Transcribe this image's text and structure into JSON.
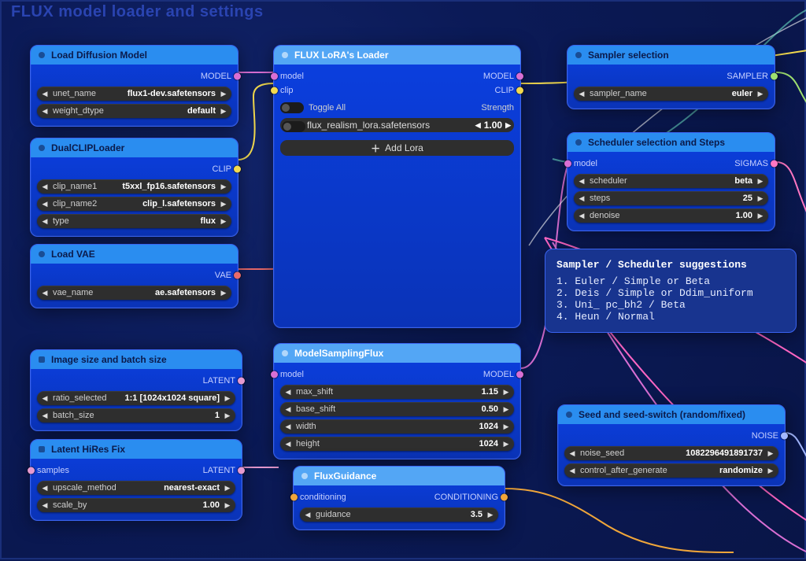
{
  "region_label": "FLUX model loader and settings",
  "nodes": {
    "load_diffusion": {
      "title": "Load Diffusion Model",
      "out_model": "MODEL",
      "rows": [
        {
          "label": "unet_name",
          "value": "flux1-dev.safetensors"
        },
        {
          "label": "weight_dtype",
          "value": "default"
        }
      ]
    },
    "dual_clip": {
      "title": "DualCLIPLoader",
      "out_clip": "CLIP",
      "rows": [
        {
          "label": "clip_name1",
          "value": "t5xxl_fp16.safetensors"
        },
        {
          "label": "clip_name2",
          "value": "clip_l.safetensors"
        },
        {
          "label": "type",
          "value": "flux"
        }
      ]
    },
    "load_vae": {
      "title": "Load VAE",
      "out_vae": "VAE",
      "rows": [
        {
          "label": "vae_name",
          "value": "ae.safetensors"
        }
      ]
    },
    "image_size": {
      "title": "Image size and batch size",
      "out_latent": "LATENT",
      "rows": [
        {
          "label": "ratio_selected",
          "value": "1:1 [1024x1024 square]"
        },
        {
          "label": "batch_size",
          "value": "1"
        }
      ]
    },
    "latent_hires": {
      "title": "Latent HiRes Fix",
      "in_samples": "samples",
      "out_latent": "LATENT",
      "rows": [
        {
          "label": "upscale_method",
          "value": "nearest-exact"
        },
        {
          "label": "scale_by",
          "value": "1.00"
        }
      ]
    },
    "lora": {
      "title": "FLUX LoRA's Loader",
      "in_model": "model",
      "in_clip": "clip",
      "out_model": "MODEL",
      "out_clip": "CLIP",
      "toggle_label": "Toggle All",
      "strength_label": "Strength",
      "items": [
        {
          "name": "flux_realism_lora.safetensors",
          "value": "1.00"
        }
      ],
      "add_label": "Add Lora"
    },
    "model_sampling": {
      "title": "ModelSamplingFlux",
      "in_model": "model",
      "out_model": "MODEL",
      "rows": [
        {
          "label": "max_shift",
          "value": "1.15"
        },
        {
          "label": "base_shift",
          "value": "0.50"
        },
        {
          "label": "width",
          "value": "1024"
        },
        {
          "label": "height",
          "value": "1024"
        }
      ]
    },
    "flux_guidance": {
      "title": "FluxGuidance",
      "in_cond": "conditioning",
      "out_cond": "CONDITIONING",
      "rows": [
        {
          "label": "guidance",
          "value": "3.5"
        }
      ]
    },
    "sampler": {
      "title": "Sampler selection",
      "out": "SAMPLER",
      "rows": [
        {
          "label": "sampler_name",
          "value": "euler"
        }
      ]
    },
    "scheduler": {
      "title": "Scheduler selection and Steps",
      "in_model": "model",
      "out": "SIGMAS",
      "rows": [
        {
          "label": "scheduler",
          "value": "beta"
        },
        {
          "label": "steps",
          "value": "25"
        },
        {
          "label": "denoise",
          "value": "1.00"
        }
      ]
    },
    "seed": {
      "title": "Seed and seed-switch (random/fixed)",
      "out": "NOISE",
      "rows": [
        {
          "label": "noise_seed",
          "value": "1082296491891737"
        },
        {
          "label": "control_after_generate",
          "value": "randomize"
        }
      ]
    }
  },
  "note": {
    "title": "Sampler / Scheduler suggestions",
    "lines": [
      "1. Euler / Simple or Beta",
      "2. Deis / Simple or Ddim_uniform",
      "3. Uni_ pc_bh2 / Beta",
      "4. Heun / Normal"
    ]
  }
}
